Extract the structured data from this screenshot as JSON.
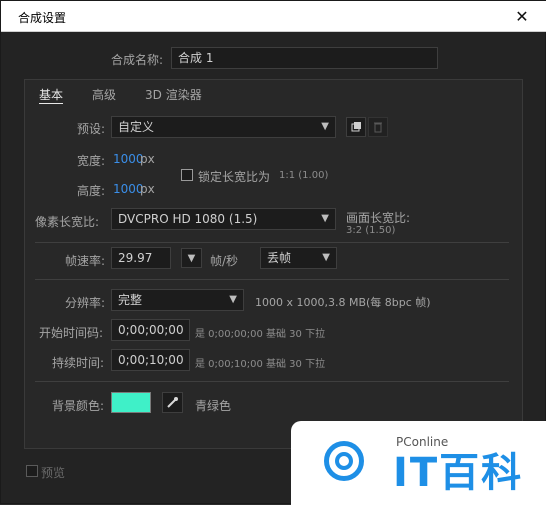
{
  "window": {
    "title": "合成设置",
    "close_glyph": "✕"
  },
  "name_row": {
    "label": "合成名称:",
    "value": "合成 1"
  },
  "tabs": [
    {
      "label": "基本",
      "active": true
    },
    {
      "label": "高级"
    },
    {
      "label": "3D 渲染器"
    }
  ],
  "preset": {
    "label": "预设:",
    "value": "自定义"
  },
  "width": {
    "label": "宽度:",
    "value": "1000",
    "unit": "px"
  },
  "height": {
    "label": "高度:",
    "value": "1000",
    "unit": "px"
  },
  "lock": {
    "label": "锁定长宽比为",
    "value": "1:1 (1.00)"
  },
  "pixel_aspect": {
    "label": "像素长宽比:",
    "value": "DVCPRO HD 1080 (1.5)"
  },
  "frame_aspect": {
    "label": "画面长宽比:",
    "value": "3:2 (1.50)"
  },
  "frame_rate": {
    "label": "帧速率:",
    "value": "29.97",
    "unit": "帧/秒",
    "drop": "丢帧"
  },
  "resolution": {
    "label": "分辨率:",
    "value": "完整",
    "info": "1000 x 1000,3.8 MB(每 8bpc 帧)"
  },
  "start_tc": {
    "label": "开始时间码:",
    "value": "0;00;00;00",
    "info": "是 0;00;00;00 基础 30 下拉"
  },
  "duration": {
    "label": "持续时间:",
    "value": "0;00;10;00",
    "info": "是 0;00;10;00 基础 30 下拉"
  },
  "bg": {
    "label": "背景颜色:",
    "color_name": "青绿色",
    "color": "#3ff0c8"
  },
  "preview": {
    "label": "预览"
  },
  "watermark": {
    "brand": "PConline",
    "big": "IT百科"
  }
}
